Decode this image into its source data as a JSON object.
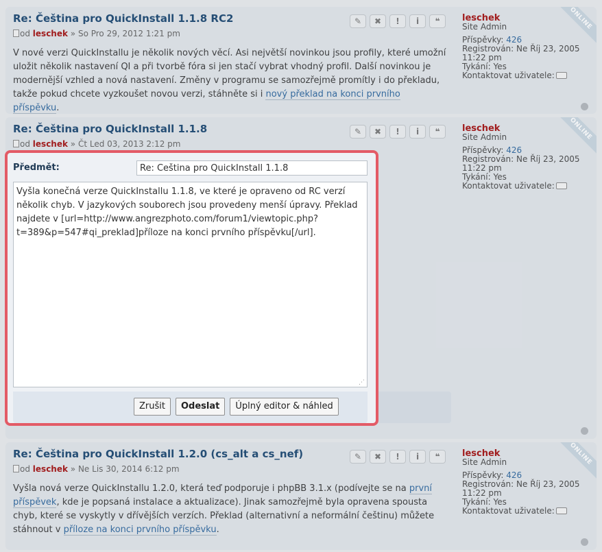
{
  "posts": [
    {
      "title": "Re: Čeština pro QuickInstall 1.1.8 RC2",
      "meta_prefix": "od",
      "author": "leschek",
      "date": "» So Pro 29, 2012 1:21 pm",
      "body_text": "V nové verzi QuickInstallu je několik nových věcí. Asi největší novinkou jsou profily, které umožní uložit několik nastavení QI a při tvorbě fóra si jen stačí vybrat vhodný profil. Další novinkou je modernější vzhled a nová nastavení. Změny v programu se samozřejmě promítly i do překladu, takže pokud chcete vyzkoušet novou verzi, stáhněte si i ",
      "body_link": "nový překlad na konci prvního příspěvku",
      "body_after": "."
    },
    {
      "title": "Re: Čeština pro QuickInstall 1.1.8",
      "meta_prefix": "od",
      "author": "leschek",
      "date": "» Čt Led 03, 2013 2:12 pm"
    },
    {
      "title": "Re: Čeština pro QuickInstall 1.2.0 (cs_alt a cs_nef)",
      "meta_prefix": "od",
      "author": "leschek",
      "date": "» Ne Lis 30, 2014 6:12 pm",
      "body_text": "Vyšla nová verze QuickInstallu 1.2.0, která teď podporuje i phpBB 3.1.x (podívejte se na ",
      "body_link": "první příspěvek",
      "body_mid": ", kde je popsaná instalace a aktualizace). Jinak samozřejmě byla opravena spousta chyb, které se vyskytly v dřívějších verzích. Překlad (alternativní a neformální češtinu) můžete stáhnout v ",
      "body_link2": "příloze na konci prvního příspěvku",
      "body_after": "."
    }
  ],
  "profile": {
    "name": "leschek",
    "rank": "Site Admin",
    "posts_label": "Příspěvky:",
    "posts_value": "426",
    "registered_label": "Registrován:",
    "registered_value": "Ne Říj 23, 2005 11:22 pm",
    "tykani_label": "Tykání:",
    "tykani_value": "Yes",
    "contact_label": "Kontaktovat uživatele:",
    "online_badge": "ONLINE"
  },
  "post_buttons": [
    "✎",
    "✖",
    "!",
    "i",
    "❝"
  ],
  "dialog": {
    "subject_label": "Předmět:",
    "subject_value": "Re: Čeština pro QuickInstall 1.1.8",
    "message": "Vyšla konečná verze QuickInstallu 1.1.8, ve které je opraveno od RC verzí několik chyb. V jazykových souborech jsou provedeny menší úpravy. Překlad najdete v [url=http://www.angrezphoto.com/forum1/viewtopic.php?t=389&p=547#qi_preklad]příloze na konci prvního příspěvku[/url].",
    "cancel_label": "Zrušit",
    "submit_label": "Odeslat",
    "full_editor_label": "Úplný editor & náhled"
  },
  "colors": {
    "accent_border": "#e35b66",
    "author": "#a51515",
    "title": "#1f4a74",
    "link": "#326aa0"
  }
}
